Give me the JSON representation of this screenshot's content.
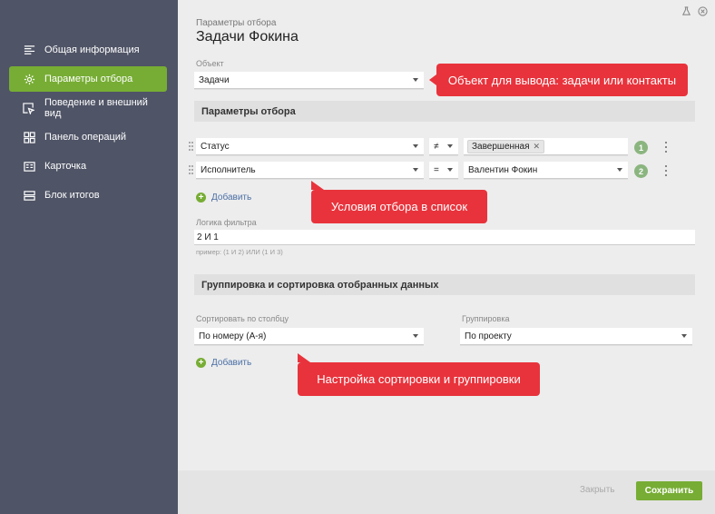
{
  "sidebar": {
    "items": [
      {
        "label": "Общая информация",
        "icon": "list-icon",
        "active": false
      },
      {
        "label": "Параметры отбора",
        "icon": "gear-icon",
        "active": true
      },
      {
        "label": "Поведение и внешний вид",
        "icon": "cursor-window-icon",
        "active": false
      },
      {
        "label": "Панель операций",
        "icon": "grid-icon",
        "active": false
      },
      {
        "label": "Карточка",
        "icon": "card-icon",
        "active": false
      },
      {
        "label": "Блок итогов",
        "icon": "totals-icon",
        "active": false
      }
    ]
  },
  "header": {
    "breadcrumb": "Параметры отбора",
    "title": "Задачи Фокина"
  },
  "object_field": {
    "label": "Объект",
    "value": "Задачи"
  },
  "filter_section": {
    "title": "Параметры отбора",
    "conditions": [
      {
        "field": "Статус",
        "operator": "≠",
        "value_tag": "Завершенная",
        "number": "1"
      },
      {
        "field": "Исполнитель",
        "operator": "=",
        "value": "Валентин Фокин",
        "number": "2"
      }
    ],
    "add_label": "Добавить",
    "logic_label": "Логика фильтра",
    "logic_value": "2 И 1",
    "logic_hint": "пример: (1 И 2) ИЛИ (1 И 3)"
  },
  "grouping_section": {
    "title": "Группировка и сортировка отобранных данных",
    "sort_label": "Сортировать по столбцу",
    "sort_value": "По номеру (А-я)",
    "group_label": "Группировка",
    "group_value": "По проекту",
    "add_label": "Добавить"
  },
  "callouts": {
    "object": "Объект для вывода: задачи или контакты",
    "conditions": "Условия отбора в список",
    "sorting": "Настройка сортировки и группировки"
  },
  "footer": {
    "close_label": "Закрыть",
    "save_label": "Сохранить"
  },
  "colors": {
    "sidebar_bg": "#4f5466",
    "accent_green": "#77ad34",
    "callout_red": "#e8333c"
  }
}
